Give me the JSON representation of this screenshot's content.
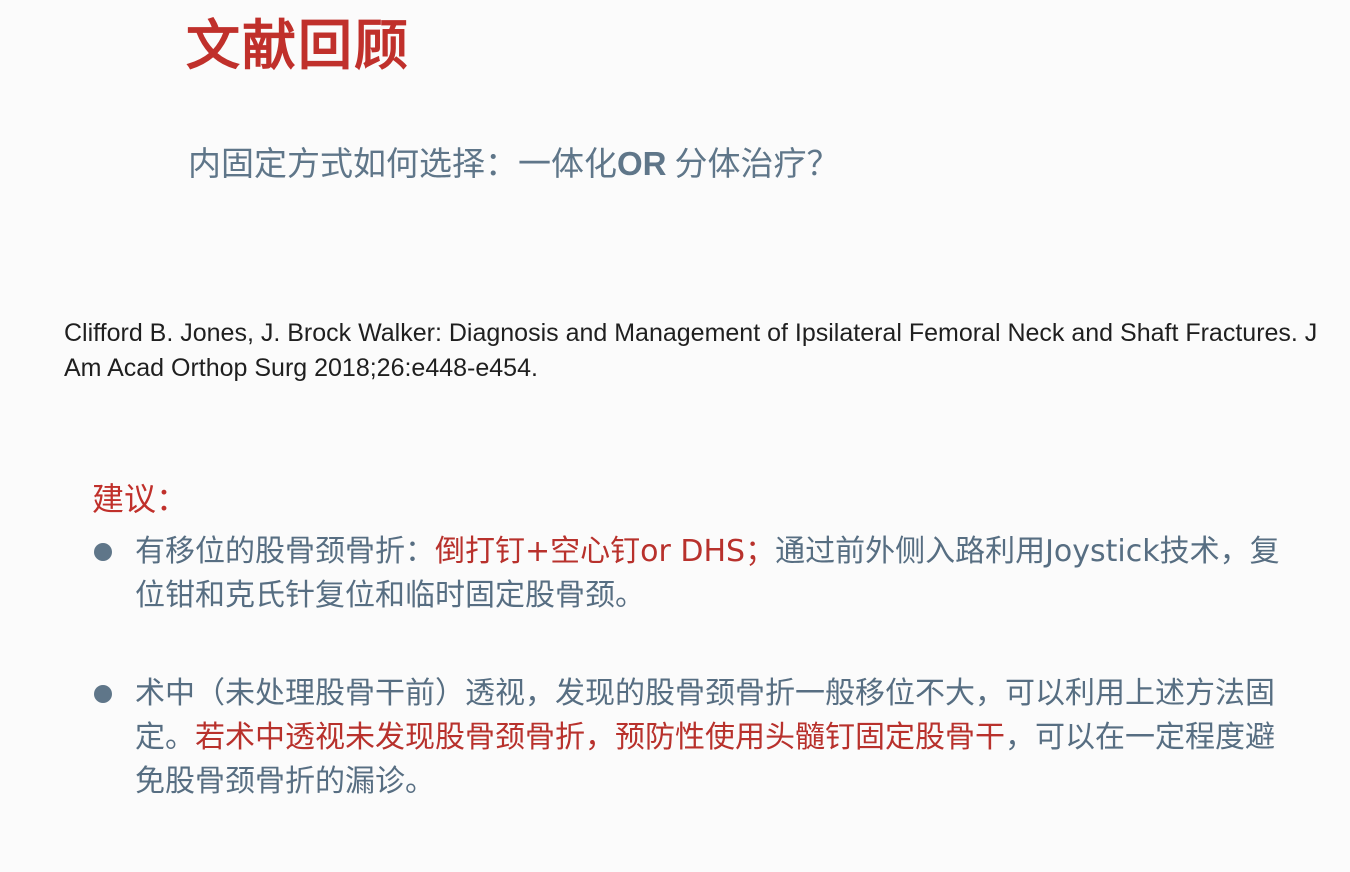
{
  "slide": {
    "title": "文献回顾",
    "subtitle_before": "内固定方式如何选择：一体化",
    "subtitle_or": "OR",
    "subtitle_after": "分体治疗？",
    "reference": "Clifford B. Jones, J. Brock Walker: Diagnosis and Management of Ipsilateral Femoral Neck and Shaft Fractures. J Am Acad Orthop Surg 2018;26:e448-e454.",
    "advice_heading": "建议：",
    "bullets": [
      {
        "part1": "有移位的股骨颈骨折：",
        "part2_highlight": "倒打钉+空心钉or DHS；",
        "part3": "通过前外侧入路利用Joystick技术，复位钳和克氏针复位和临时固定股骨颈。"
      },
      {
        "part1": "术中（未处理股骨干前）透视，发现的股骨颈骨折一般移位不大，可以利用上述方法固定。",
        "part2_highlight": "若术中透视未发现股骨颈骨折，预防性使用头髓钉固定股骨干",
        "part3": "，可以在一定程度避免股骨颈骨折的漏诊。"
      }
    ]
  }
}
